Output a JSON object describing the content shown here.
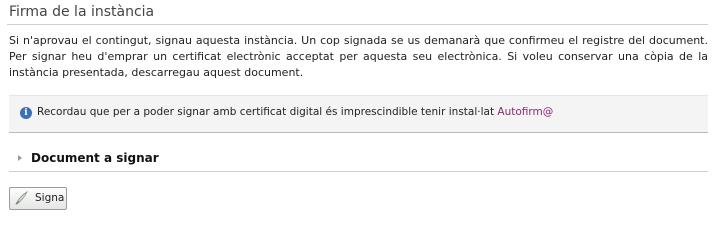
{
  "section": {
    "title": "Firma de la instància"
  },
  "intro": {
    "text": "Si n'aprovau el contingut, signau aquesta instància. Un cop signada se us demanarà que confirmeu el registre del document. Per signar heu d'emprar un certificat electrònic acceptat per aquesta seu electrònica. Si voleu conservar una còpia de la instància presentada, descarregau aquest document."
  },
  "notice": {
    "icon": "info-icon",
    "text": "Recordau que per a poder signar amb certificat digital és imprescindible tenir instal·lat ",
    "link_label": "Autofirm@",
    "link_color": "#8a2a6f"
  },
  "accordion": {
    "label": "Document a signar",
    "icon": "chevron-right-icon"
  },
  "actions": {
    "sign_label": "Signa",
    "sign_icon": "pen-icon"
  }
}
